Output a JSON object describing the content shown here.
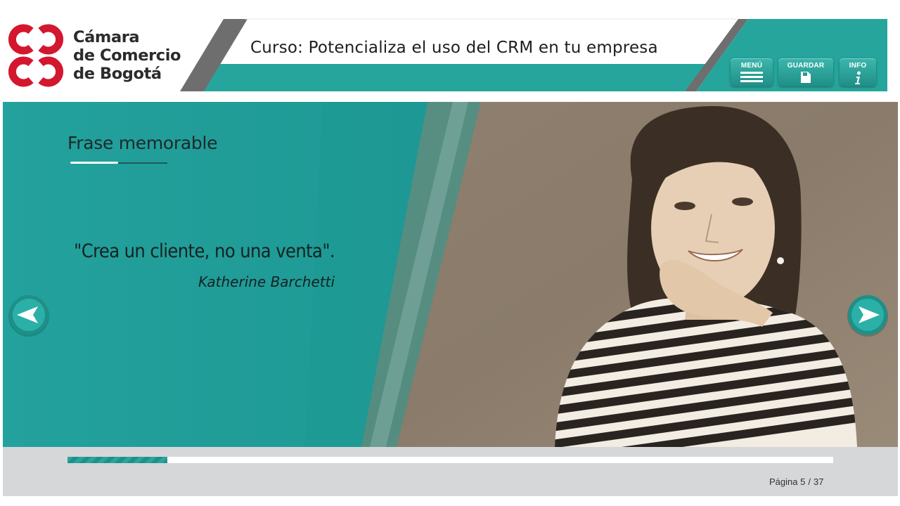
{
  "brand": {
    "lines": [
      "Cámara",
      "de Comercio",
      "de Bogotá"
    ],
    "logo_color": "#d3172e"
  },
  "header": {
    "course_title": "Curso: Potencializa el uso del CRM en tu empresa",
    "buttons": {
      "menu": {
        "label": "MENÚ",
        "icon": "hamburger-icon"
      },
      "guardar": {
        "label": "GUARDAR",
        "icon": "save-icon"
      },
      "info": {
        "label": "INFO",
        "icon": "info-icon"
      }
    },
    "accent_color": "#26a59d"
  },
  "slide": {
    "heading": "Frase memorable",
    "quote": "\"Crea un cliente, no una venta\".",
    "author": "Katherine Barchetti",
    "photo": "portrait-photo"
  },
  "navigation": {
    "prev_icon": "arrow-left-icon",
    "next_icon": "arrow-right-icon"
  },
  "footer": {
    "progress_fraction": 0.13,
    "page_label": "Página",
    "current_page": "5",
    "total_pages": "37"
  }
}
